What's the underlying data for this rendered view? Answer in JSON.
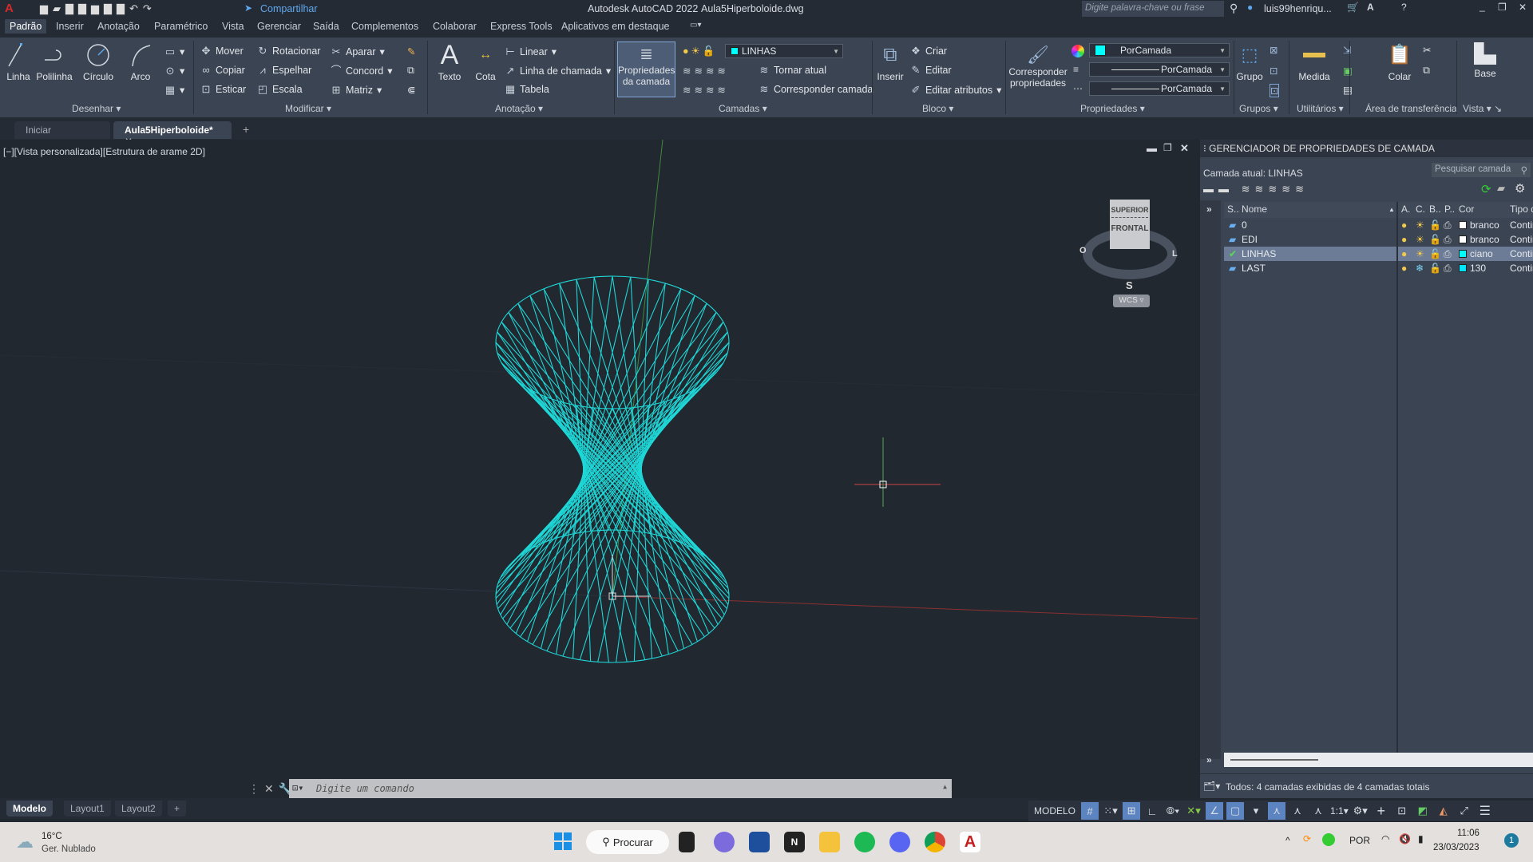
{
  "titlebar": {
    "app_title": "Autodesk AutoCAD 2022",
    "file_name": "Aula5Hiperboloide.dwg",
    "share": "Compartilhar",
    "search_placeholder": "Digite palavra-chave ou frase",
    "user": "luis99henriqu..."
  },
  "menu": {
    "tabs": [
      "Padrão",
      "Inserir",
      "Anotação",
      "Paramétrico",
      "Vista",
      "Gerenciar",
      "Saída",
      "Complementos",
      "Colaborar",
      "Express Tools",
      "Aplicativos em destaque"
    ],
    "active": "Padrão"
  },
  "ribbon": {
    "desenhar": {
      "label": "Desenhar",
      "items": [
        "Linha",
        "Polilinha",
        "Círculo",
        "Arco"
      ]
    },
    "modificar": {
      "label": "Modificar",
      "items": [
        "Mover",
        "Rotacionar",
        "Aparar",
        "Copiar",
        "Espelhar",
        "Concord",
        "Esticar",
        "Escala",
        "Matriz"
      ]
    },
    "anotacao": {
      "label": "Anotação",
      "items": [
        "Texto",
        "Cota",
        "Linear",
        "Linha de chamada",
        "Tabela"
      ]
    },
    "camadas": {
      "label": "Camadas",
      "layer_props": "Propriedades da camada",
      "current_layer": "LINHAS",
      "make_current": "Tornar atual",
      "match_layer": "Corresponder camada"
    },
    "bloco": {
      "label": "Bloco",
      "insert": "Inserir",
      "items": [
        "Criar",
        "Editar",
        "Editar atributos"
      ]
    },
    "propriedades": {
      "label": "Propriedades",
      "match": "Corresponder propriedades",
      "color": "PorCamada",
      "lineweight": "PorCamada",
      "linetype": "PorCamada"
    },
    "grupos": {
      "label": "Grupos",
      "item": "Grupo"
    },
    "utilitarios": {
      "label": "Utilitários",
      "item": "Medida"
    },
    "area": {
      "label": "Área de transferência",
      "item": "Colar"
    },
    "vista": {
      "label": "Vista",
      "item": "Base"
    }
  },
  "doctabs": {
    "start": "Iniciar",
    "file": "Aula5Hiperboloide*"
  },
  "viewport": {
    "label": "[−][Vista personalizada][Estrutura de arame 2D]",
    "viewcube": {
      "top": "SUPERIOR",
      "front": "FRONTAL",
      "west": "O",
      "east": "L",
      "south": "S",
      "ucs": "WCS"
    },
    "shape_color": "#1fd6d6"
  },
  "layers": {
    "title": "GERENCIADOR DE PROPRIEDADES DE CAMADA",
    "current": "Camada atual: LINHAS",
    "search_placeholder": "Pesquisar camada",
    "columns": [
      "S..",
      "Nome",
      "A.",
      "C.",
      "B..",
      "P..",
      "Cor",
      "Tipo d"
    ],
    "rows": [
      {
        "name": "0",
        "color": "branco",
        "hex": "#ffffff",
        "linetype": "Contir",
        "frozen": false
      },
      {
        "name": "EDI",
        "color": "branco",
        "hex": "#ffffff",
        "linetype": "Contir",
        "frozen": false
      },
      {
        "name": "LINHAS",
        "color": "ciano",
        "hex": "#00ffff",
        "linetype": "Contir",
        "frozen": false,
        "current": true
      },
      {
        "name": "LAST",
        "color": "130",
        "hex": "#00e5ff",
        "linetype": "Contir",
        "frozen": true
      }
    ],
    "footer": "Todos: 4 camadas exibidas de 4 camadas totais"
  },
  "command": {
    "placeholder": "Digite um comando"
  },
  "layouts": {
    "tabs": [
      "Modelo",
      "Layout1",
      "Layout2"
    ],
    "active": "Modelo"
  },
  "status": {
    "model": "MODELO",
    "scale": "1:1"
  },
  "taskbar": {
    "temp": "16°C",
    "weather": "Ger. Nublado",
    "search": "Procurar",
    "lang": "POR",
    "time": "11:06",
    "date": "23/03/2023",
    "badge": "1"
  }
}
